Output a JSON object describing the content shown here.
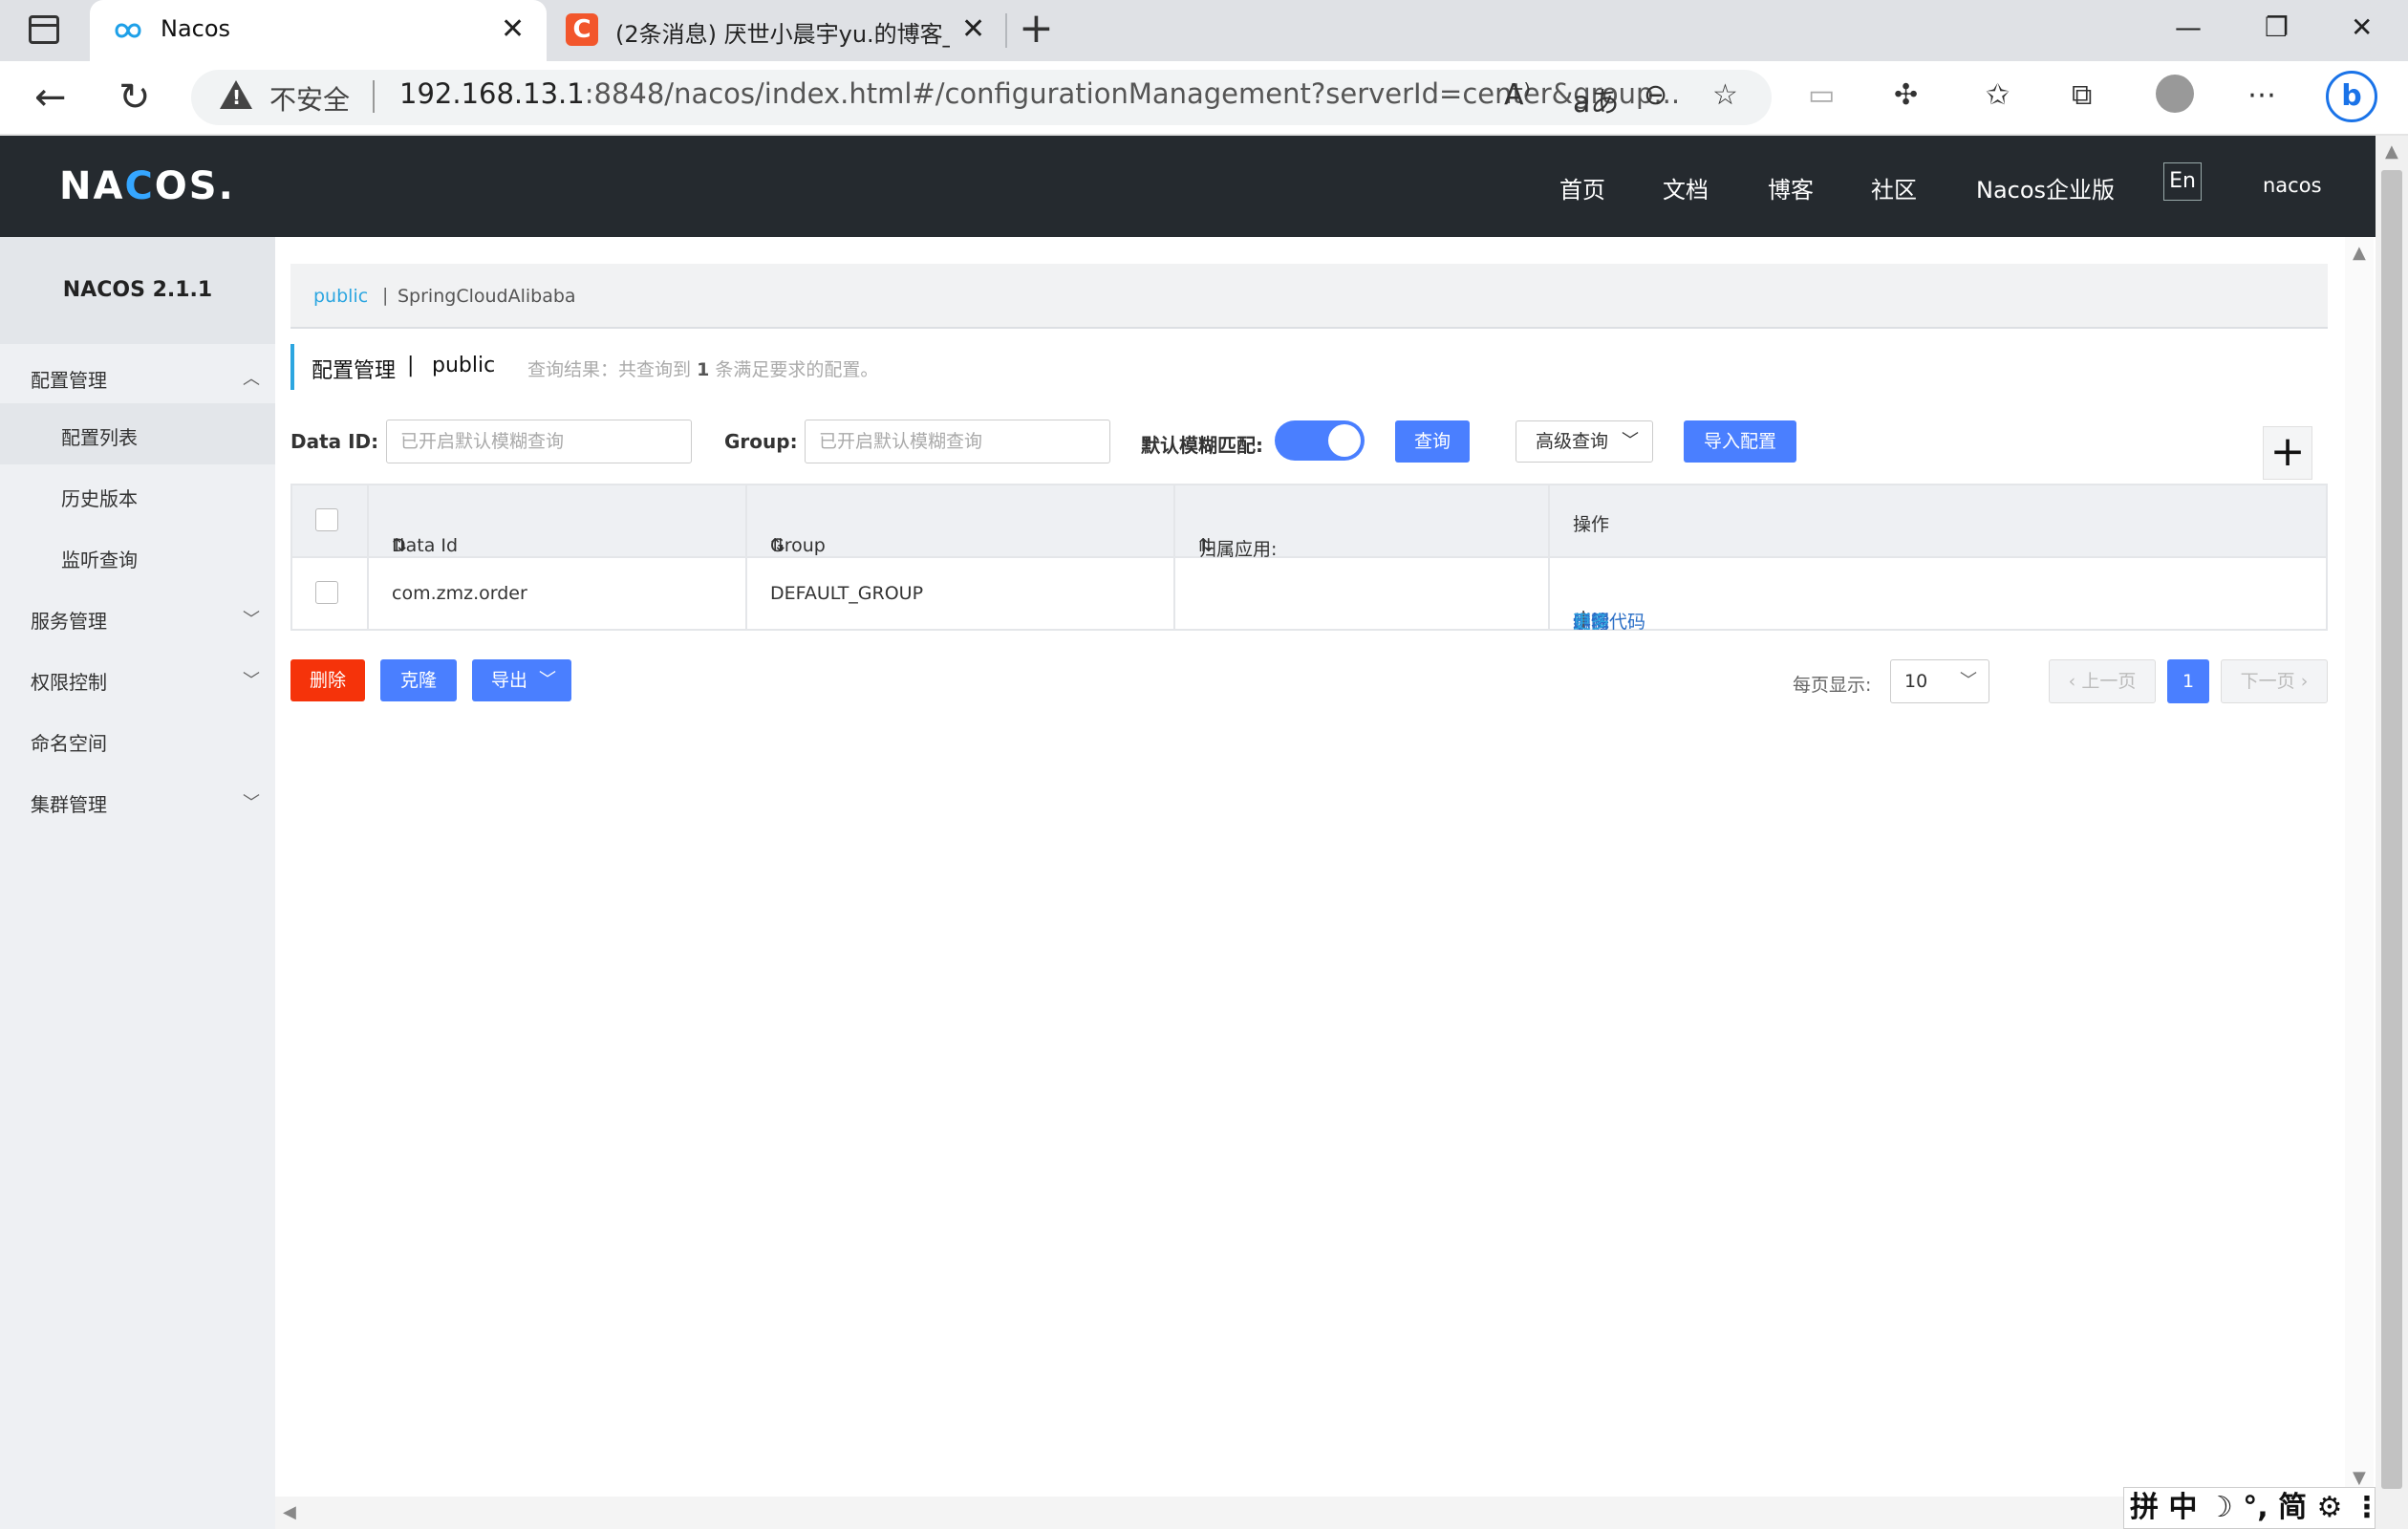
{
  "browser": {
    "active_tab_title": "Nacos",
    "second_tab_title": "(2条消息) 厌世小晨宇yu.的博客_C",
    "insecure_label": "不安全",
    "url_host": "192.168.13.1",
    "url_rest": ":8848/nacos/index.html#/configurationManagement?serverId=center&group...",
    "read_aloud_icon": "A)",
    "translate_icon": "aあ"
  },
  "header": {
    "logo": "NACOS.",
    "nav": [
      "首页",
      "文档",
      "博客",
      "社区",
      "Nacos企业版"
    ],
    "lang": "En",
    "user": "nacos"
  },
  "sidebar": {
    "version": "NACOS 2.1.1",
    "items": [
      {
        "label": "配置管理"
      },
      {
        "label": "配置列表"
      },
      {
        "label": "历史版本"
      },
      {
        "label": "监听查询"
      },
      {
        "label": "服务管理"
      },
      {
        "label": "权限控制"
      },
      {
        "label": "命名空间"
      },
      {
        "label": "集群管理"
      }
    ]
  },
  "namespaces": {
    "active": "public",
    "separator": "|",
    "other": "SpringCloudAlibaba"
  },
  "page": {
    "title": "配置管理",
    "separator": "|",
    "namespace": "public",
    "result_prefix": "查询结果：共查询到",
    "result_count": "1",
    "result_suffix": "条满足要求的配置。"
  },
  "filters": {
    "dataid_label": "Data ID:",
    "dataid_placeholder": "已开启默认模糊查询",
    "group_label": "Group:",
    "group_placeholder": "已开启默认模糊查询",
    "fuzzy_label": "默认模糊匹配:",
    "fuzzy_on": true,
    "query_button": "查询",
    "advanced_button": "高级查询",
    "import_button": "导入配置",
    "add_button": "+"
  },
  "table": {
    "columns": [
      "Data Id",
      "Group",
      "归属应用:",
      "操作"
    ],
    "rows": [
      {
        "data_id": "com.zmz.order",
        "group": "DEFAULT_GROUP",
        "app": ""
      }
    ],
    "actions": [
      "详情",
      "示例代码",
      "编辑",
      "删除",
      "更多"
    ]
  },
  "bulk": {
    "delete": "删除",
    "clone": "克隆",
    "export": "导出"
  },
  "pagination": {
    "page_size_label": "每页显示:",
    "page_size": "10",
    "prev": "上一页",
    "current": "1",
    "next": "下一页"
  },
  "ime": "拼 中 ☽ °, 简 ⚙ ⋮",
  "colors": {
    "header_bg": "#252a2f",
    "accent": "#4a7fff",
    "danger": "#f5330a",
    "link": "#2a6ec6",
    "namespace_active": "#2ca6e0"
  }
}
